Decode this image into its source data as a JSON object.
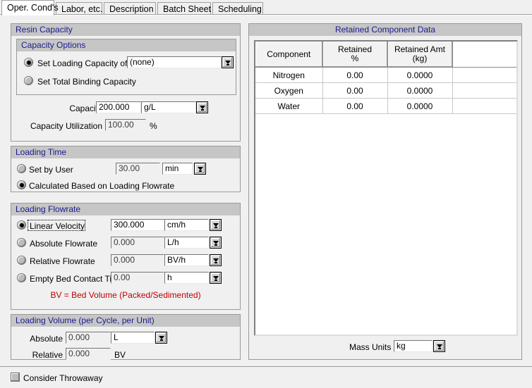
{
  "tabs": [
    {
      "label": "Oper. Cond's",
      "active": true
    },
    {
      "label": "Labor, etc.",
      "active": false
    },
    {
      "label": "Description",
      "active": false
    },
    {
      "label": "Batch Sheet",
      "active": false
    },
    {
      "label": "Scheduling",
      "active": false
    }
  ],
  "resin_capacity": {
    "title": "Resin Capacity",
    "capacity_options": {
      "title": "Capacity Options",
      "set_loading_capacity_label": "Set Loading Capacity of",
      "set_loading_capacity_selected": true,
      "loading_capacity_value": "(none)",
      "set_total_binding_label": "Set Total Binding Capacity",
      "set_total_binding_selected": false
    },
    "capacity_label": "Capacity",
    "capacity_value": "200.000",
    "capacity_units": "g/L",
    "utilization_label": "Capacity Utilization",
    "utilization_value": "100.00",
    "utilization_units": "%"
  },
  "loading_time": {
    "title": "Loading Time",
    "set_by_user_label": "Set by User",
    "set_by_user_selected": false,
    "time_value": "30.00",
    "time_units": "min",
    "calculated_label": "Calculated Based on Loading Flowrate",
    "calculated_selected": true
  },
  "loading_flowrate": {
    "title": "Loading Flowrate",
    "note": "BV = Bed Volume (Packed/Sedimented)",
    "rows": [
      {
        "label": "Linear Velocity",
        "selected": true,
        "value": "300.000",
        "units": "cm/h",
        "focused": true
      },
      {
        "label": "Absolute Flowrate",
        "selected": false,
        "value": "0.000",
        "units": "L/h",
        "focused": false
      },
      {
        "label": "Relative Flowrate",
        "selected": false,
        "value": "0.000",
        "units": "BV/h",
        "focused": false
      },
      {
        "label": "Empty Bed Contact Time",
        "selected": false,
        "value": "0.00",
        "units": "h",
        "focused": false
      }
    ]
  },
  "loading_volume": {
    "title": "Loading Volume (per Cycle, per Unit)",
    "absolute_label": "Absolute",
    "absolute_value": "0.000",
    "absolute_units": "L",
    "relative_label": "Relative",
    "relative_value": "0.000",
    "relative_units": "BV"
  },
  "consider_throwaway": {
    "label": "Consider Throwaway",
    "checked": false
  },
  "retained": {
    "title": "Retained Component Data",
    "columns": [
      "Component",
      "Retained\n%",
      "Retained Amt\n(kg)",
      ""
    ],
    "col_component": "Component",
    "col_retained_pct_l1": "Retained",
    "col_retained_pct_l2": "%",
    "col_retained_amt_l1": "Retained Amt",
    "col_retained_amt_l2": "(kg)",
    "rows": [
      {
        "component": "Nitrogen",
        "retained_pct": "0.00",
        "retained_amt": "0.0000"
      },
      {
        "component": "Oxygen",
        "retained_pct": "0.00",
        "retained_amt": "0.0000"
      },
      {
        "component": "Water",
        "retained_pct": "0.00",
        "retained_amt": "0.0000"
      }
    ],
    "mass_units_label": "Mass Units",
    "mass_units_value": "kg"
  },
  "icons": {
    "dropdown": "chevron-down-icon"
  },
  "colors": {
    "group_header_text": "#1b1b8f",
    "group_header_bg": "#c6c6c6",
    "note_text": "#c00000",
    "window_bg": "#f0f0f0"
  }
}
